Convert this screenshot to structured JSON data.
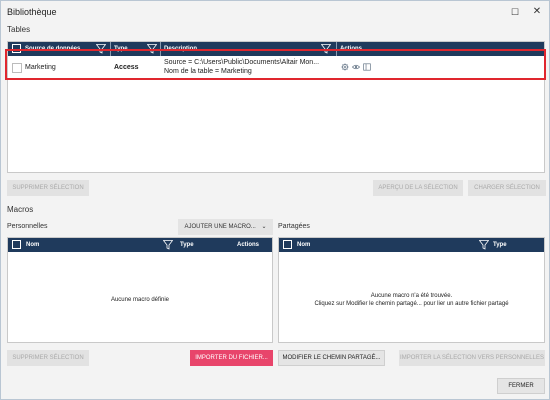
{
  "window": {
    "title": "Bibliothèque",
    "maximize_glyph": "☐",
    "close_glyph": "✕"
  },
  "tables": {
    "section_label": "Tables",
    "columns": {
      "source": "Source de données",
      "type": "Type",
      "description": "Description",
      "actions": "Actions"
    },
    "rows": [
      {
        "source": "Marketing",
        "type": "Access",
        "description_line1": "Source = C:\\Users\\Public\\Documents\\Altair Mon...",
        "description_line2": "Nom de la table = Marketing",
        "action_icons": [
          "gear-icon",
          "eye-icon",
          "panel-icon"
        ]
      }
    ],
    "buttons": {
      "delete_selection": "Supprimer sélection",
      "preview_selection": "Aperçu de la sélection",
      "load_selection": "Charger sélection"
    }
  },
  "macros": {
    "section_label": "Macros",
    "personal": {
      "label": "Personnelles",
      "add_macro": "Ajouter une macro...",
      "columns": {
        "name": "Nom",
        "type": "Type",
        "actions": "Actions"
      },
      "empty": "Aucune macro définie",
      "delete_selection": "Supprimer sélection",
      "import_file": "Importer du fichier..."
    },
    "shared": {
      "label": "Partagées",
      "columns": {
        "name": "Nom",
        "type": "Type"
      },
      "empty_line1": "Aucune macro n'a été trouvée.",
      "empty_line2": "Cliquez sur Modifier le chemin partagé... pour lier un autre fichier partagé",
      "modify_path": "Modifier le chemin partagé...",
      "import_to_personal": "Importer la sélection vers personnelles"
    }
  },
  "footer": {
    "close": "Fermer"
  },
  "colors": {
    "header_bg": "#1f3a5c",
    "highlight": "#e0262e",
    "accent_pink": "#e8456b"
  }
}
